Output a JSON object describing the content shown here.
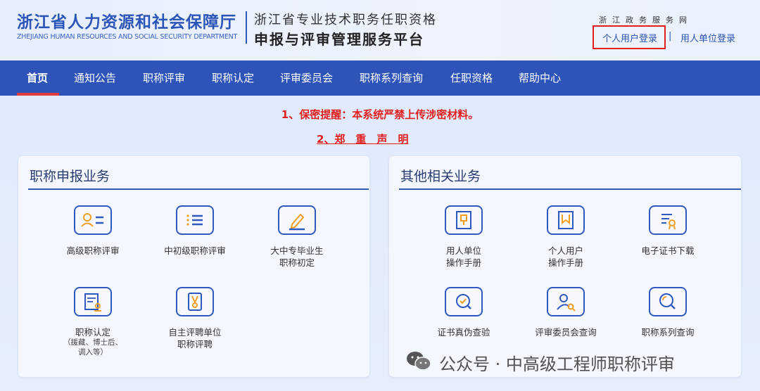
{
  "header": {
    "org_cn": "浙江省人力资源和社会保障厅",
    "org_en": "ZHEJIANG HUMAN RESOURCES AND SOCIAL SECURITY DEPARTMENT",
    "platform_line1": "浙江省专业技术职务任职资格",
    "platform_line2": "申报与评审管理服务平台",
    "gov_net_chars": [
      "浙",
      "江",
      "政",
      "务",
      "服",
      "务",
      "网"
    ],
    "login_personal": "个人用户登录",
    "login_separator": "|",
    "login_unit": "用人单位登录",
    "highlight_color": "#e21f1f"
  },
  "nav": {
    "items": [
      "首页",
      "通知公告",
      "职称评审",
      "职称认定",
      "评审委员会",
      "职称系列查询",
      "任职资格",
      "帮助中心"
    ],
    "active_index": 0,
    "bg_color": "#2e54b9"
  },
  "notices": {
    "line1": "1、保密提醒：本系统严禁上传涉密材料。",
    "line2": "2、郑　重　声　明"
  },
  "left_panel": {
    "title": "职称申报业务",
    "tiles": [
      {
        "label": "高级职称评审",
        "sub": "",
        "icon": "id-card-icon"
      },
      {
        "label": "中初级职称评审",
        "sub": "",
        "icon": "list-icon"
      },
      {
        "label": "大中专毕业生\n职称初定",
        "sub": "",
        "icon": "edit-pen-icon"
      },
      {
        "label": "职称认定",
        "sub": "（援藏、博士后、\n调入等）",
        "icon": "certificate-stamp-icon"
      },
      {
        "label": "自主评聘单位\n职称评聘",
        "sub": "",
        "icon": "badge-icon"
      }
    ]
  },
  "right_panel": {
    "title": "其他相关业务",
    "tiles": [
      {
        "label": "用人单位\n操作手册",
        "sub": "",
        "icon": "unit-manual-icon"
      },
      {
        "label": "个人用户\n操作手册",
        "sub": "",
        "icon": "bookmark-icon"
      },
      {
        "label": "电子证书下载",
        "sub": "",
        "icon": "certificate-download-icon"
      },
      {
        "label": "证书真伪查验",
        "sub": "",
        "icon": "verify-search-icon"
      },
      {
        "label": "评审委员会查询",
        "sub": "",
        "icon": "user-search-icon"
      },
      {
        "label": "职称系列查询",
        "sub": "",
        "icon": "search-icon"
      }
    ]
  },
  "watermark": {
    "text": "公众号 · 中高级工程师职称评审",
    "icon": "wechat-logo"
  }
}
